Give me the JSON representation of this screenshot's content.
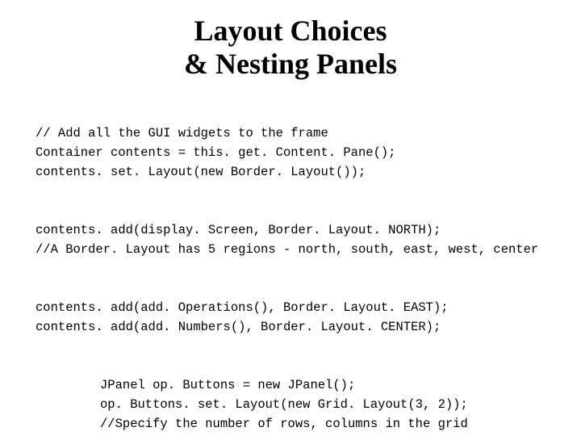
{
  "title_line1": "Layout Choices",
  "title_line2": "& Nesting Panels",
  "block1": {
    "l1": "// Add all the GUI widgets to the frame",
    "l2": "Container contents = this. get. Content. Pane();",
    "l3": "contents. set. Layout(new Border. Layout());"
  },
  "block2": {
    "l1": "contents. add(display. Screen, Border. Layout. NORTH);",
    "l2": "//A Border. Layout has 5 regions - north, south, east, west, center"
  },
  "block3": {
    "l1": "contents. add(add. Operations(), Border. Layout. EAST);",
    "l2": "contents. add(add. Numbers(), Border. Layout. CENTER);"
  },
  "block4": {
    "l1": "JPanel op. Buttons = new JPanel();",
    "l2": "op. Buttons. set. Layout(new Grid. Layout(3, 2));",
    "l3": "//Specify the number of rows, columns in the grid"
  }
}
